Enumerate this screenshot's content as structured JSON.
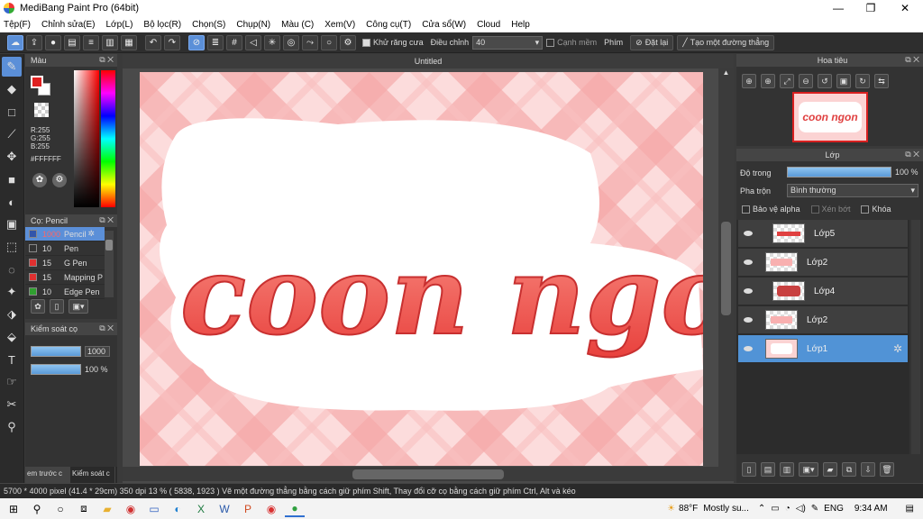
{
  "window": {
    "title": "MediBang Paint Pro (64bit)",
    "minimize": "—",
    "maximize": "❐",
    "close": "✕"
  },
  "menu": [
    "Tệp(F)",
    "Chỉnh sửa(E)",
    "Lớp(L)",
    "Bộ lọc(R)",
    "Chọn(S)",
    "Chụp(N)",
    "Màu (C)",
    "Xem(V)",
    "Công cụ(T)",
    "Cửa sổ(W)",
    "Cloud",
    "Help"
  ],
  "toolbar": {
    "antialias_label": "Khử răng cưa",
    "adjust_label": "Điều chỉnh",
    "adjust_value": "40",
    "soft_edge_label": "Cạnh mềm",
    "key_label": "Phím",
    "reset_label": "Đặt lại",
    "straight_line_label": "Tạo một đường thẳng"
  },
  "color_panel": {
    "title": "Màu",
    "r": "R:255",
    "g": "G:255",
    "b": "B:255",
    "hex": "#FFFFFF",
    "fg_color": "#e02020",
    "bg_color": "#ffffff"
  },
  "brush_panel": {
    "title": "Cọ: Pencil",
    "items": [
      {
        "size": "1000",
        "name": "Pencil",
        "color": "#3355aa"
      },
      {
        "size": "10",
        "name": "Pen",
        "color": "#333333"
      },
      {
        "size": "15",
        "name": "G Pen",
        "color": "#e03030"
      },
      {
        "size": "15",
        "name": "Mapping P",
        "color": "#e03030"
      },
      {
        "size": "10",
        "name": "Edge Pen",
        "color": "#30a030"
      }
    ]
  },
  "control_panel": {
    "title": "Kiểm soát cọ",
    "size_value": "1000",
    "opacity_value": "100 %"
  },
  "left_tabs": [
    "em trước c",
    "Kiểm soát c"
  ],
  "canvas": {
    "title": "Untitled",
    "artwork_text": "coon ngon"
  },
  "navigator": {
    "title": "Hoa tiêu"
  },
  "layer_panel": {
    "title": "Lớp",
    "opacity_label": "Độ trong",
    "opacity_value": "100 %",
    "blend_label": "Pha trộn",
    "blend_value": "Bình thường",
    "protect_alpha_label": "Bảo vệ alpha",
    "clipping_label": "Xén bớt",
    "lock_label": "Khóa",
    "layers": [
      {
        "name": "Lớp5"
      },
      {
        "name": "Lớp2"
      },
      {
        "name": "Lớp4"
      },
      {
        "name": "Lớp2"
      },
      {
        "name": "Lớp1"
      }
    ]
  },
  "status": {
    "text": "5700 * 4000 pixel  (41.4 * 29cm)   350 dpi   13 %   ( 5838, 1923 )  Vẽ một đường thẳng bằng cách giữ phím Shift, Thay đổi cỡ cọ bằng cách giữ phím Ctrl, Alt và kéo"
  },
  "taskbar": {
    "weather": "88°F",
    "weather_desc": "Mostly su...",
    "lang": "ENG",
    "time": "9:34 AM"
  }
}
